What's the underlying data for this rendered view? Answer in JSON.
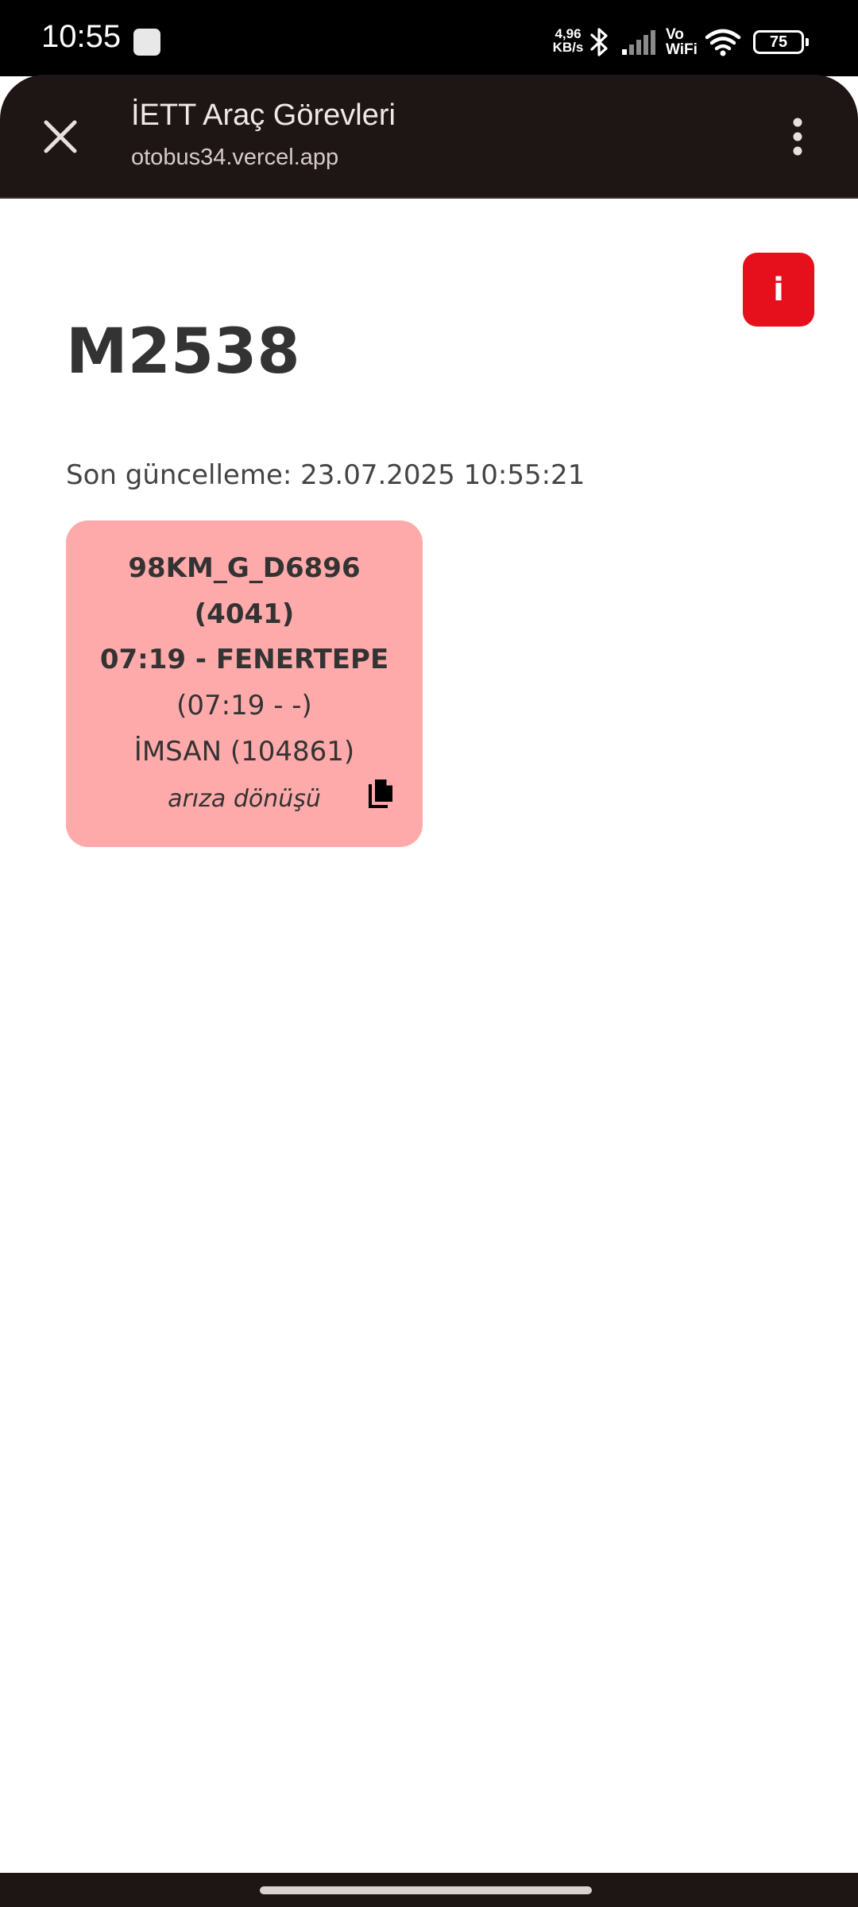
{
  "status_bar": {
    "time": "10:55",
    "net_speed_value": "4,96",
    "net_speed_unit": "KB/s",
    "vowifi_top": "Vo",
    "vowifi_bottom": "WiFi",
    "battery_level": "75"
  },
  "toolbar": {
    "title": "İETT Araç Görevleri",
    "url": "otobus34.vercel.app"
  },
  "page": {
    "info_label": "i",
    "title": "M2538",
    "last_update": "Son güncelleme: 23.07.2025 10:55:21"
  },
  "task_card": {
    "background_color": "#ffaaaa",
    "code": "98KM_G_D6896",
    "number": "(4041)",
    "trip": "07:19 - FENERTEPE",
    "times": "(07:19 - -)",
    "operator": "İMSAN (104861)",
    "note": "arıza dönüşü"
  },
  "colors": {
    "info_button": "#e5101c",
    "toolbar": "#1e1615"
  },
  "icons": [
    "close-icon",
    "more-vert-icon",
    "copy-icon",
    "bluetooth-icon",
    "signal-icon",
    "wifi-icon"
  ]
}
